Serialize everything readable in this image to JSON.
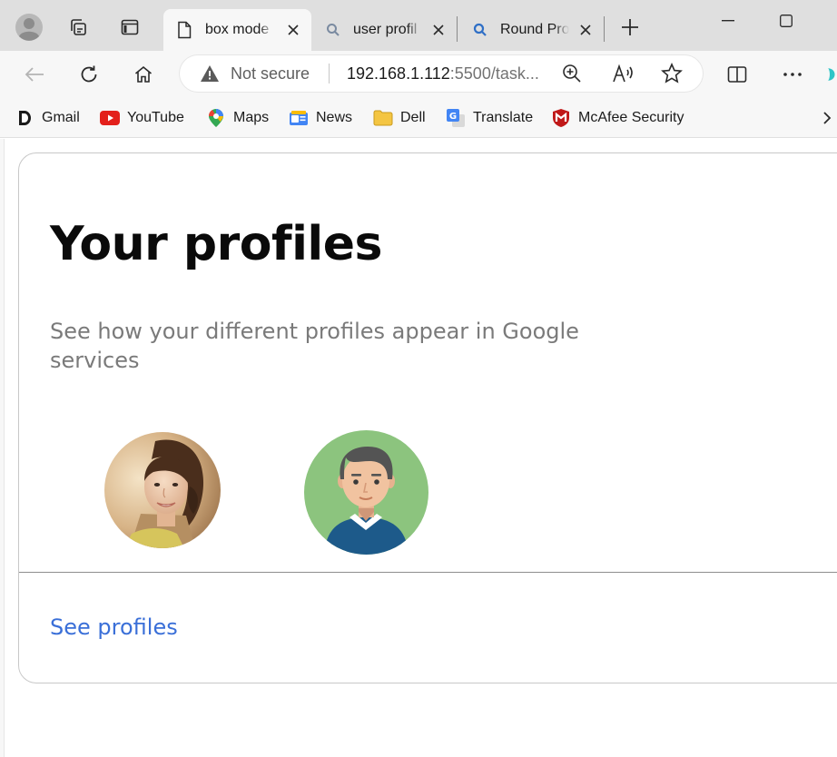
{
  "browser": {
    "tabs": [
      {
        "title": "box mode",
        "active": true,
        "icon": "page-icon"
      },
      {
        "title": "user profil",
        "active": false,
        "icon": "search-icon"
      },
      {
        "title": "Round Pro",
        "active": false,
        "icon": "search-icon"
      }
    ],
    "address": {
      "security_label": "Not secure",
      "url_host": "192.168.1.112",
      "url_rest": ":5500/task..."
    },
    "bookmarks": [
      {
        "label": "Gmail",
        "icon": "gmail-icon"
      },
      {
        "label": "YouTube",
        "icon": "youtube-icon"
      },
      {
        "label": "Maps",
        "icon": "maps-icon"
      },
      {
        "label": "News",
        "icon": "news-icon"
      },
      {
        "label": "Dell",
        "icon": "folder-icon"
      },
      {
        "label": "Translate",
        "icon": "translate-icon"
      },
      {
        "label": "McAfee Security",
        "icon": "mcafee-icon"
      }
    ]
  },
  "page": {
    "title": "Your profiles",
    "subtitle": "See how your different profiles appear in Google services",
    "link_label": "See profiles",
    "avatars": [
      {
        "icon": "woman-photo-avatar"
      },
      {
        "icon": "man-cartoon-avatar"
      }
    ]
  },
  "colors": {
    "link": "#3a6fd8",
    "tabstrip_bg": "#dfdfdf",
    "toolbar_bg": "#f7f7f7",
    "avatar_green": "#8cc47e",
    "avatar_shirt": "#1d5a8a"
  }
}
